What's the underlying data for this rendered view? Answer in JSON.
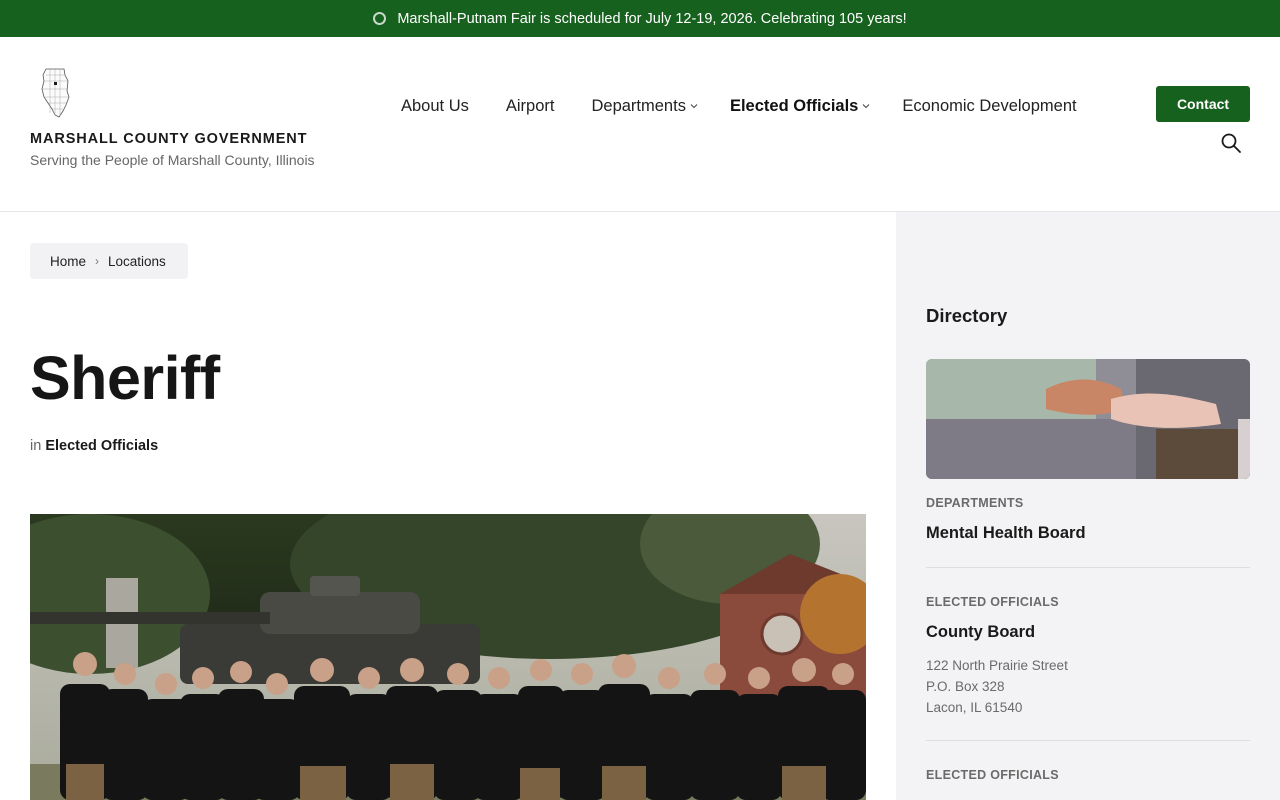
{
  "announcement": {
    "text": "Marshall-Putnam Fair is scheduled for July 12-19, 2026. Celebrating 105 years!"
  },
  "header": {
    "site_title": "MARSHALL COUNTY GOVERNMENT",
    "tagline": "Serving the People of Marshall County, Illinois",
    "contact_label": "Contact",
    "nav": [
      {
        "label": "About Us",
        "has_dropdown": false,
        "active": false
      },
      {
        "label": "Airport",
        "has_dropdown": false,
        "active": false
      },
      {
        "label": "Departments",
        "has_dropdown": true,
        "active": false
      },
      {
        "label": "Elected Officials",
        "has_dropdown": true,
        "active": true
      },
      {
        "label": "Economic Development",
        "has_dropdown": false,
        "active": false
      }
    ]
  },
  "breadcrumb": {
    "home": "Home",
    "current": "Locations"
  },
  "page": {
    "title": "Sheriff",
    "in_prefix": "in",
    "category": "Elected Officials"
  },
  "sidebar": {
    "title": "Directory",
    "entries": [
      {
        "category": "Departments",
        "name": "Mental Health Board",
        "address": []
      },
      {
        "category": "Elected Officials",
        "name": "County Board",
        "address": [
          "122 North Prairie Street",
          "P.O. Box 328",
          "Lacon, IL 61540"
        ]
      },
      {
        "category": "Elected Officials",
        "name": "",
        "address": []
      }
    ]
  },
  "colors": {
    "brand_green": "#17611f",
    "sidebar_bg": "#f3f3f5"
  },
  "icons": {
    "announcement": "ring-icon",
    "search": "search-icon",
    "dropdown": "chevron-down-icon",
    "logo": "illinois-map-icon"
  }
}
